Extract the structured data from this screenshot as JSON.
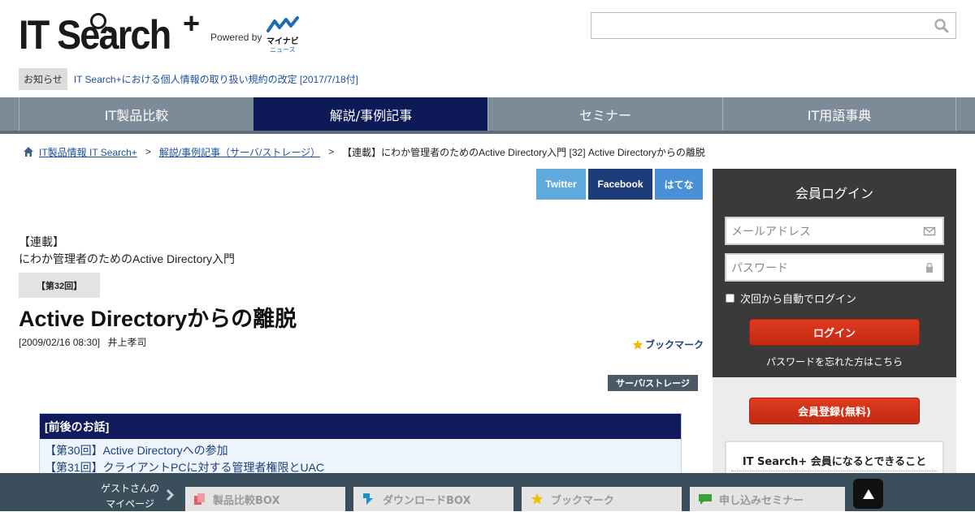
{
  "header": {
    "logo_text": "IT Search",
    "logo_plus": "+",
    "powered_by": "Powered by",
    "partner_name": "マイナビ",
    "partner_sub": "ニュース",
    "search_placeholder": ""
  },
  "notice": {
    "tag": "お知らせ",
    "link": "IT Search+における個人情報の取り扱い規約の改定 [2017/7/18付]"
  },
  "nav": {
    "items": [
      {
        "label": "IT製品比較",
        "active": false
      },
      {
        "label": "解説/事例記事",
        "active": true
      },
      {
        "label": "セミナー",
        "active": false
      },
      {
        "label": "IT用語事典",
        "active": false
      }
    ]
  },
  "breadcrumb": {
    "home": "IT製品情報 IT Search+",
    "section": "解説/事例記事（サーバ/ストレージ）",
    "current": "【連載】にわか管理者のためのActive Directory入門 [32] Active Directoryからの離脱",
    "separator": ">"
  },
  "share": {
    "twitter": "Twitter",
    "facebook": "Facebook",
    "hatena": "はてな"
  },
  "article": {
    "series_tag": "【連載】",
    "series_name": "にわか管理者のためのActive Directory入門",
    "episode": "【第32回】",
    "title": "Active Directoryからの離脱",
    "date": "[2009/02/16 08:30]",
    "author": "井上孝司",
    "bookmark": "ブックマーク",
    "category": "サーバ/ストレージ"
  },
  "related": {
    "heading": "[前後のお話]",
    "items": [
      "【第30回】Active Directoryへの参加",
      "【第31回】クライアントPCに対する管理者権限とUAC"
    ]
  },
  "login": {
    "title": "会員ログイン",
    "email_placeholder": "メールアドレス",
    "password_placeholder": "パスワード",
    "remember": "次回から自動でログイン",
    "login_button": "ログイン",
    "forgot": "パスワードを忘れた方はこちら",
    "register_button": "会員登録(無料)",
    "benefit_title": "IT Search+ 会員になるとできること"
  },
  "bottom_bar": {
    "guest_line1": "ゲストさんの",
    "guest_line2": "マイページ",
    "tabs": [
      {
        "label": "製品比較BOX",
        "icon": "compare-icon",
        "color": "#e85a6a"
      },
      {
        "label": "ダウンロードBOX",
        "icon": "download-icon",
        "color": "#1e8fc8"
      },
      {
        "label": "ブックマーク",
        "icon": "star-icon",
        "color": "#f0c000"
      },
      {
        "label": "申し込みセミナー",
        "icon": "chat-icon",
        "color": "#3aa23a"
      }
    ]
  },
  "colors": {
    "nav_bg": "#7d8a97",
    "nav_active": "#0e1a57",
    "twitter": "#5fa9dd",
    "facebook": "#1d3d7a",
    "hatena": "#4a90d6",
    "accent_red": "#d0331a",
    "bottom_bar": "#3b4e5b"
  }
}
